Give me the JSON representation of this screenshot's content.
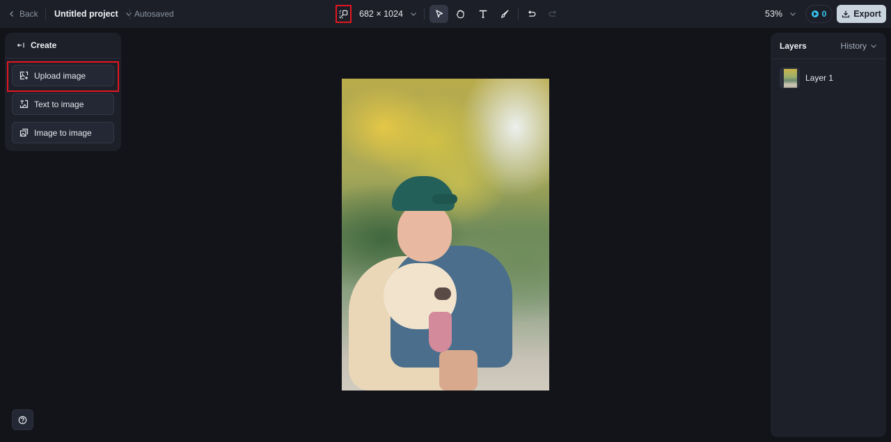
{
  "topbar": {
    "back_label": "Back",
    "project_name": "Untitled project",
    "save_status": "Autosaved",
    "canvas_size": "682 × 1024",
    "zoom_level": "53%",
    "credits": "0",
    "export_label": "Export",
    "tools": [
      {
        "name": "select",
        "icon": "cursor-arrow-icon",
        "active": true
      },
      {
        "name": "hand",
        "icon": "hand-icon",
        "active": false
      },
      {
        "name": "text",
        "icon": "text-icon",
        "active": false
      },
      {
        "name": "brush",
        "icon": "brush-icon",
        "active": false
      },
      {
        "name": "undo",
        "icon": "undo-icon",
        "active": false
      },
      {
        "name": "redo",
        "icon": "redo-icon",
        "active": false
      }
    ]
  },
  "create_panel": {
    "title": "Create",
    "items": [
      {
        "label": "Upload image",
        "icon": "upload-image-icon",
        "highlighted": true
      },
      {
        "label": "Text to image",
        "icon": "text-to-image-icon"
      },
      {
        "label": "Image to image",
        "icon": "image-to-image-icon"
      }
    ]
  },
  "layers_panel": {
    "title": "Layers",
    "history_label": "History",
    "layers": [
      {
        "name": "Layer 1"
      }
    ]
  },
  "canvas": {
    "image_description": "Boy in green cap hugging a golden retriever outdoors"
  },
  "colors": {
    "accent_credit": "#38c6f4",
    "highlight_outline": "#e3161f",
    "export_bg": "#c9d4df"
  }
}
